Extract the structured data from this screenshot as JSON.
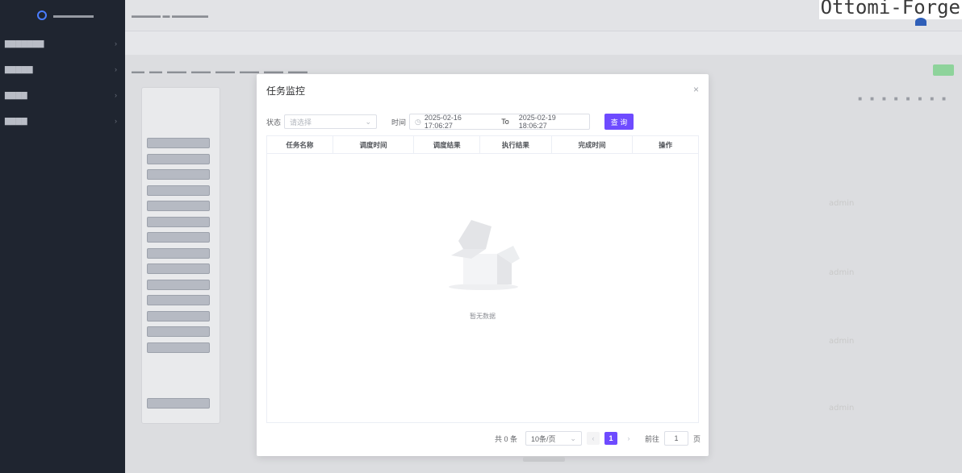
{
  "brand": {
    "text": "Ottomi-Forge"
  },
  "dialog": {
    "title": "任务监控",
    "filter": {
      "status_label": "状态",
      "status_placeholder": "请选择",
      "time_label": "时间",
      "start_time": "2025-02-16 17:06:27",
      "to_label": "To",
      "end_time": "2025-02-19 18:06:27",
      "query_label": "查 询"
    },
    "table": {
      "columns": [
        "任务名称",
        "调度时间",
        "调度结果",
        "执行结果",
        "完成时间",
        "操作"
      ],
      "empty_text": "暂无数据"
    },
    "pagination": {
      "total": "共 0 条",
      "page_size": "10条/页",
      "current_page": "1",
      "goto_label": "前往",
      "goto_value": "1",
      "page_unit": "页"
    }
  },
  "watermark": "admin"
}
